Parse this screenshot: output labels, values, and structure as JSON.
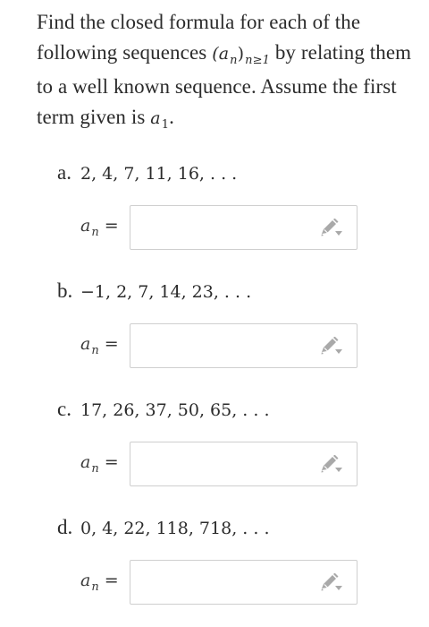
{
  "prompt": {
    "intro": "Find the closed formula for each of the following sequences ",
    "seq_symbol": "(a",
    "seq_sub_n": "n",
    "seq_close": ")",
    "seq_sub_range": "n≥1",
    "middle": " by relating them to a well known sequence. Assume the first term given is ",
    "first_term": "a",
    "first_term_sub": "1",
    "end": "."
  },
  "parts": [
    {
      "letter": "a.",
      "sequence": "2, 4, 7, 11, 16, . . .",
      "answer_symbol": "a",
      "answer_sub": "n",
      "equals": "=",
      "answer_value": "",
      "edit_icon": "pencil-dropdown-icon"
    },
    {
      "letter": "b.",
      "sequence": "−1, 2, 7, 14, 23, . . .",
      "answer_symbol": "a",
      "answer_sub": "n",
      "equals": "=",
      "answer_value": "",
      "edit_icon": "pencil-dropdown-icon"
    },
    {
      "letter": "c.",
      "sequence": "17, 26, 37, 50, 65, . . .",
      "answer_symbol": "a",
      "answer_sub": "n",
      "equals": "=",
      "answer_value": "",
      "edit_icon": "pencil-dropdown-icon"
    },
    {
      "letter": "d.",
      "sequence": "0, 4, 22, 118, 718, . . .",
      "answer_symbol": "a",
      "answer_sub": "n",
      "equals": "=",
      "answer_value": "",
      "edit_icon": "pencil-dropdown-icon"
    }
  ],
  "colors": {
    "text": "#2b2b2b",
    "box_border": "#cfcfcf",
    "icon": "#a9a9a9"
  }
}
